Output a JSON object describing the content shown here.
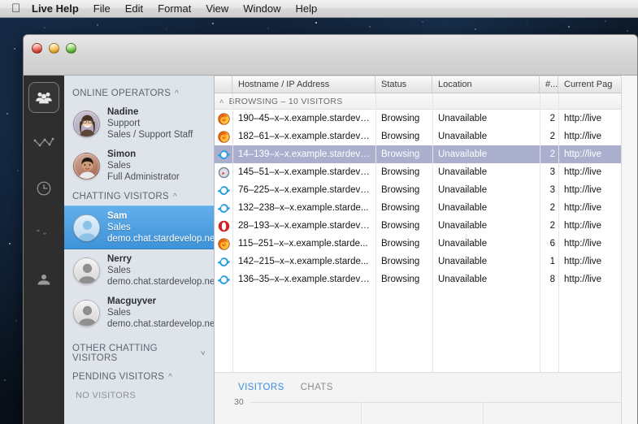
{
  "menubar": {
    "apple": "",
    "items": [
      {
        "label": "Live Help",
        "bold": true
      },
      {
        "label": "File"
      },
      {
        "label": "Edit"
      },
      {
        "label": "Format"
      },
      {
        "label": "View"
      },
      {
        "label": "Window"
      },
      {
        "label": "Help"
      }
    ]
  },
  "window": {
    "traffic": {
      "close": "close",
      "minimize": "minimize",
      "zoom": "zoom"
    }
  },
  "rail": {
    "items": [
      {
        "icon": "visitors-group-icon",
        "selected": true
      },
      {
        "icon": "line-chart-icon",
        "selected": false
      },
      {
        "icon": "clock-history-icon",
        "selected": false
      },
      {
        "icon": "quote-icon",
        "selected": false
      },
      {
        "icon": "operator-person-icon",
        "selected": false
      }
    ]
  },
  "sidebar": {
    "sections": [
      {
        "id": "online-operators",
        "title": "ONLINE OPERATORS",
        "chevron": "^"
      },
      {
        "id": "chatting-visitors",
        "title": "CHATTING VISITORS",
        "chevron": "^"
      },
      {
        "id": "other-chatting-visitors",
        "title": "OTHER CHATTING VISITORS",
        "chevron": "˅"
      },
      {
        "id": "pending-visitors",
        "title": "PENDING VISITORS",
        "chevron": "^"
      }
    ],
    "operators": [
      {
        "name": "Nadine",
        "role": "Support",
        "meta": "Sales / Support Staff",
        "avatar": "nadine"
      },
      {
        "name": "Simon",
        "role": "Sales",
        "meta": "Full Administrator",
        "avatar": "simon"
      }
    ],
    "chatting_visitors": [
      {
        "name": "Sam",
        "role": "Sales",
        "meta": "demo.chat.stardevelop.net",
        "avatar": "generic",
        "selected": true
      },
      {
        "name": "Nerry",
        "role": "Sales",
        "meta": "demo.chat.stardevelop.net",
        "avatar": "generic",
        "selected": false
      },
      {
        "name": "Macguyver",
        "role": "Sales",
        "meta": "demo.chat.stardevelop.net",
        "avatar": "generic",
        "selected": false
      }
    ],
    "pending_empty_label": "NO VISITORS"
  },
  "table": {
    "columns": [
      {
        "key": "icon",
        "label": ""
      },
      {
        "key": "hostname",
        "label": "Hostname / IP Address"
      },
      {
        "key": "status",
        "label": "Status"
      },
      {
        "key": "location",
        "label": "Location"
      },
      {
        "key": "count",
        "label": "#..."
      },
      {
        "key": "page",
        "label": "Current Pag"
      }
    ],
    "group": {
      "chevron": "˄",
      "label": "BROWSING – 10 VISITORS"
    },
    "rows": [
      {
        "icon": "firefox-icon",
        "hostname": "190–45–x–x.example.stardeve...",
        "status": "Browsing",
        "location": "Unavailable",
        "count": "2",
        "page": "http://live",
        "selected": false
      },
      {
        "icon": "firefox-icon",
        "hostname": "182–61–x–x.example.stardeve...",
        "status": "Browsing",
        "location": "Unavailable",
        "count": "2",
        "page": "http://live",
        "selected": false
      },
      {
        "icon": "internet-explorer-icon",
        "hostname": "14–139–x–x.example.stardeve...",
        "status": "Browsing",
        "location": "Unavailable",
        "count": "2",
        "page": "http://live",
        "selected": true
      },
      {
        "icon": "safari-icon",
        "hostname": "145–51–x–x.example.stardeve...",
        "status": "Browsing",
        "location": "Unavailable",
        "count": "3",
        "page": "http://live",
        "selected": false
      },
      {
        "icon": "internet-explorer-icon",
        "hostname": "76–225–x–x.example.stardeve...",
        "status": "Browsing",
        "location": "Unavailable",
        "count": "3",
        "page": "http://live",
        "selected": false
      },
      {
        "icon": "internet-explorer-icon",
        "hostname": "132–238–x–x.example.starde...",
        "status": "Browsing",
        "location": "Unavailable",
        "count": "2",
        "page": "http://live",
        "selected": false
      },
      {
        "icon": "opera-icon",
        "hostname": "28–193–x–x.example.stardeve...",
        "status": "Browsing",
        "location": "Unavailable",
        "count": "2",
        "page": "http://live",
        "selected": false
      },
      {
        "icon": "firefox-icon",
        "hostname": "115–251–x–x.example.starde...",
        "status": "Browsing",
        "location": "Unavailable",
        "count": "6",
        "page": "http://live",
        "selected": false
      },
      {
        "icon": "internet-explorer-icon",
        "hostname": "142–215–x–x.example.starde...",
        "status": "Browsing",
        "location": "Unavailable",
        "count": "1",
        "page": "http://live",
        "selected": false
      },
      {
        "icon": "internet-explorer-icon",
        "hostname": "136–35–x–x.example.stardeve...",
        "status": "Browsing",
        "location": "Unavailable",
        "count": "8",
        "page": "http://live",
        "selected": false
      }
    ]
  },
  "footer": {
    "tabs": [
      {
        "id": "visitors",
        "label": "VISITORS",
        "active": true
      },
      {
        "id": "chats",
        "label": "CHATS",
        "active": false
      }
    ]
  },
  "chart_data": {
    "type": "line",
    "title": "",
    "xlabel": "",
    "ylabel": "",
    "ytick_labels": [
      "30"
    ],
    "ylim": [
      0,
      30
    ],
    "x": [],
    "series": [],
    "grid": true,
    "legend": "none"
  },
  "colors": {
    "accent_blue": "#3b8ede",
    "selection_row": "#a9afcd",
    "sidebar_bg": "#dfe3ea",
    "rail_bg": "#2e2e2e",
    "selected_person_top": "#62aeea",
    "selected_person_bottom": "#3f93d8"
  }
}
